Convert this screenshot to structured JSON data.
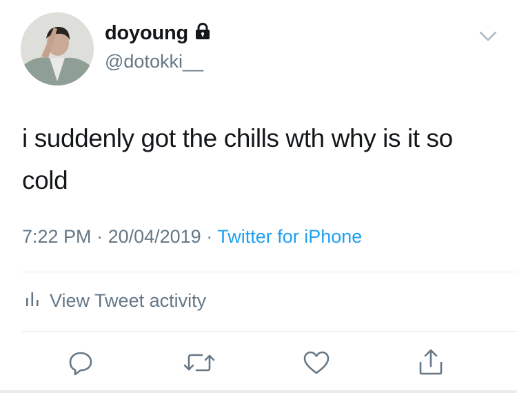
{
  "user": {
    "display_name": "doyoung",
    "handle": "@dotokki__"
  },
  "tweet": {
    "text": "i suddenly got the chills wth why is it so cold",
    "time": "7:22 PM",
    "date": "20/04/2019",
    "separator": " · ",
    "source": "Twitter for iPhone"
  },
  "activity": {
    "label": "View Tweet activity"
  },
  "icons": {
    "lock": "lock-icon",
    "chevron": "chevron-down-icon",
    "activity": "bar-chart-icon",
    "reply": "reply-icon",
    "retweet": "retweet-icon",
    "like": "like-icon",
    "share": "share-icon"
  },
  "colors": {
    "text": "#14171a",
    "secondary": "#657786",
    "link": "#1da1f2",
    "divider": "#e1e8ed"
  }
}
